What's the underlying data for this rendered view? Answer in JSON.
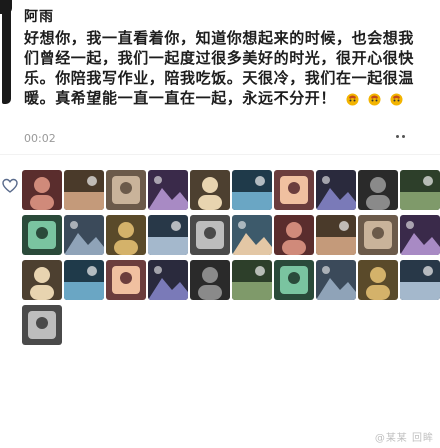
{
  "post": {
    "author": "阿雨",
    "body": "好想你，我一直看着你，知道你想起来的时候，也会想我们曾经一起，我们一起度过很多美好的时光，很开心很快乐。你陪我写作业，陪我吃饭。天很冷，我们在一起很温暖。真希望能一直一直在一起，永远不分开！",
    "time": "00:02",
    "emoji_count": 3
  },
  "likes": {
    "count": 31,
    "like_icon": "heart-outline-icon"
  },
  "watermark": "@某某 回眸",
  "colors": {
    "author": "#1b1b1b",
    "time": "#9a9a9a",
    "emoji": "#e0a100"
  }
}
